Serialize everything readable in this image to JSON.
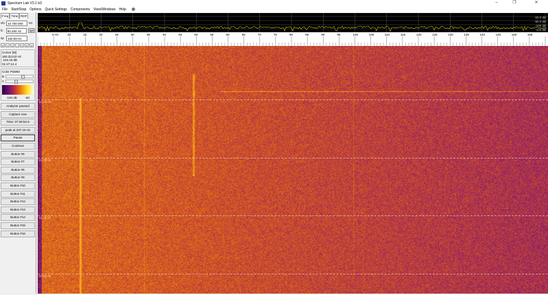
{
  "window": {
    "title": "Spectrum Lab V3.1 b3",
    "controls": [
      "–",
      "❐",
      "✕"
    ]
  },
  "menu": [
    "File",
    "Start/Stop",
    "Options",
    "Quick Settings",
    "Components",
    "View/Windows",
    "Help"
  ],
  "tabs": [
    "Freq",
    "Time",
    "RDF"
  ],
  "fields": {
    "vfo": {
      "label": "vfo",
      "value": "10 700 000",
      "unit": "Hz"
    },
    "fc": {
      "label": "fc",
      "value": "60.494 Hz",
      "button": "opt"
    },
    "sp": {
      "label": "sp",
      "value": "160.59 Hz"
    }
  },
  "scroll_buttons": [
    "«",
    "‹",
    "<",
    "-",
    "+",
    ">",
    "»"
  ],
  "cursor": {
    "title": "Cursor [M]",
    "freq": "160.32143 Hz",
    "level": "-102.33 dB",
    "time": "01:27:12.4"
  },
  "palette": {
    "title": "Color Palette",
    "b_label": "B",
    "c_label": "C",
    "b_value": 0.62,
    "c_value": 0.35,
    "min_label": "-100 dB",
    "max_label": "-50"
  },
  "buttons": [
    "Analyzer paused",
    "Capture now",
    "Time:  07:28:52.9",
    "peak at 237.15 Hz",
    "Pause",
    "Continue",
    "Button #6",
    "Button #7",
    "Button #8",
    "Button #9",
    "Button #10",
    "Button #11",
    "Button #12",
    "Button #13",
    "Button #14",
    "Button #15",
    "Button #16"
  ],
  "spectrum": {
    "db_labels": [
      "-60.0 dB",
      "-80.0 dB",
      "-100 dB",
      "-120 dB"
    ],
    "trace_color": "#c8c000"
  },
  "freq_scale": {
    "unit_label": "5 Hz",
    "ticks": [
      10,
      15,
      20,
      25,
      30,
      35,
      40,
      45,
      50,
      55,
      60,
      65,
      70,
      75,
      80,
      85,
      90,
      95,
      100,
      105,
      110,
      115,
      120,
      125,
      130,
      135,
      140,
      145,
      150,
      155
    ]
  },
  "waterfall": {
    "time_labels": [
      "01:35:00",
      "01:30:00",
      "01:25:00",
      "01:20:01"
    ]
  }
}
